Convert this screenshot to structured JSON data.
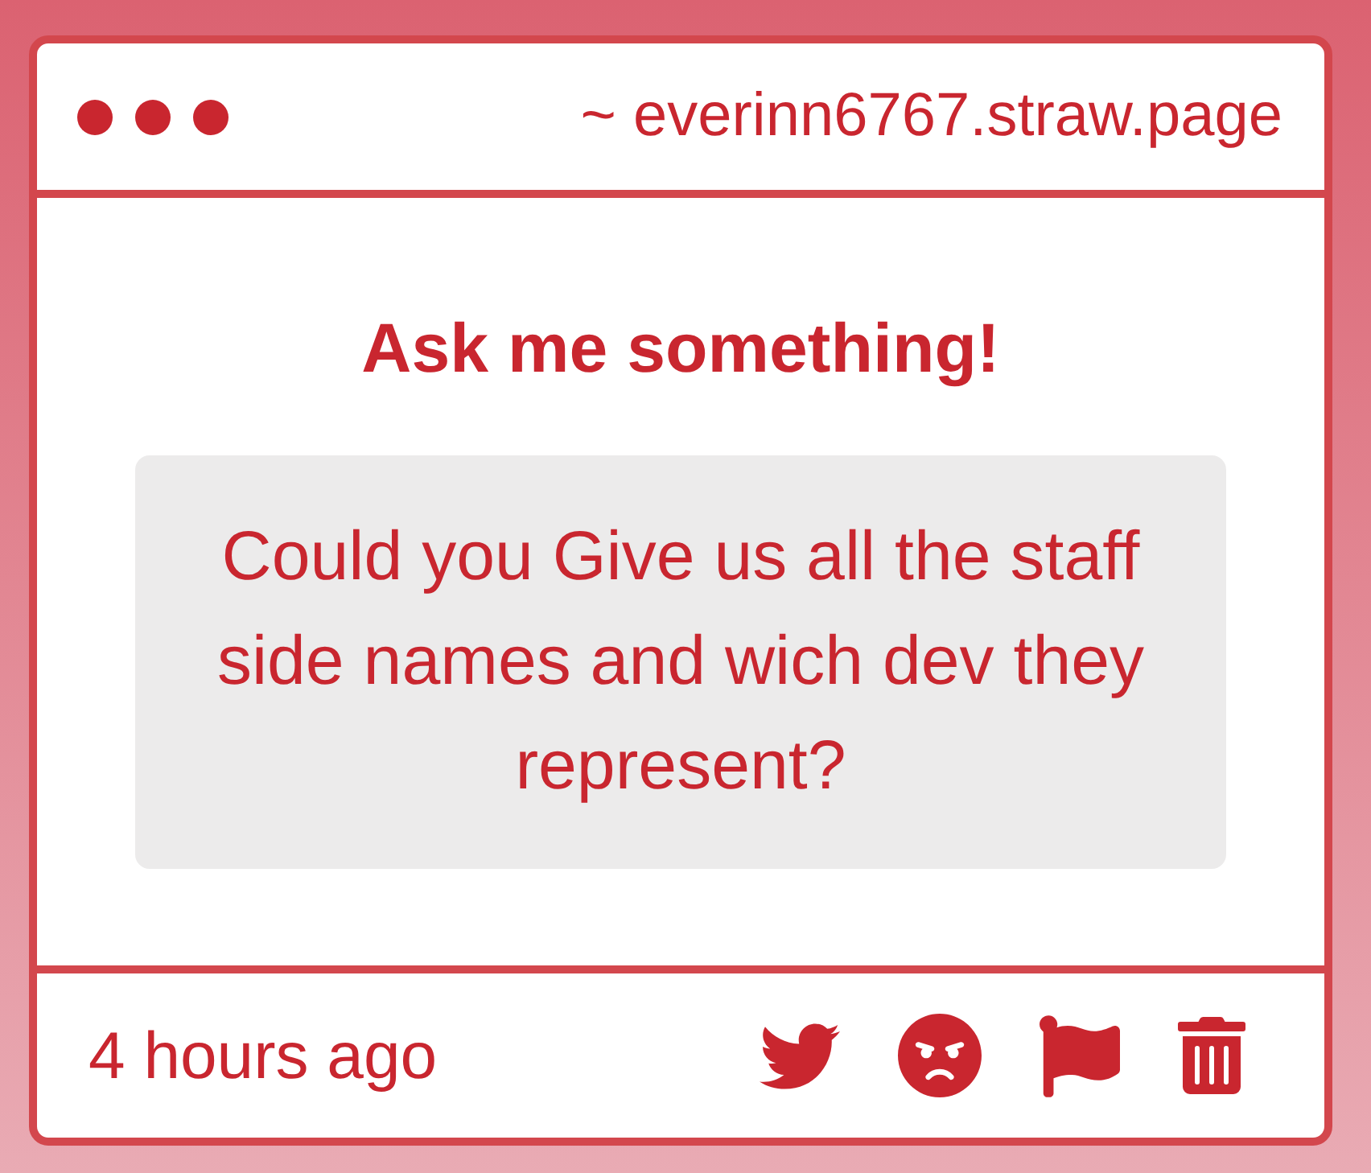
{
  "header": {
    "address": "~ everinn6767.straw.page"
  },
  "prompt": {
    "title": "Ask me something!"
  },
  "question": {
    "text": "Could you Give us all the staff side names and wich dev they represent?"
  },
  "footer": {
    "time": "4 hours ago",
    "actions": [
      {
        "kind": "twitter"
      },
      {
        "kind": "angry"
      },
      {
        "kind": "flag"
      },
      {
        "kind": "trash"
      }
    ]
  }
}
